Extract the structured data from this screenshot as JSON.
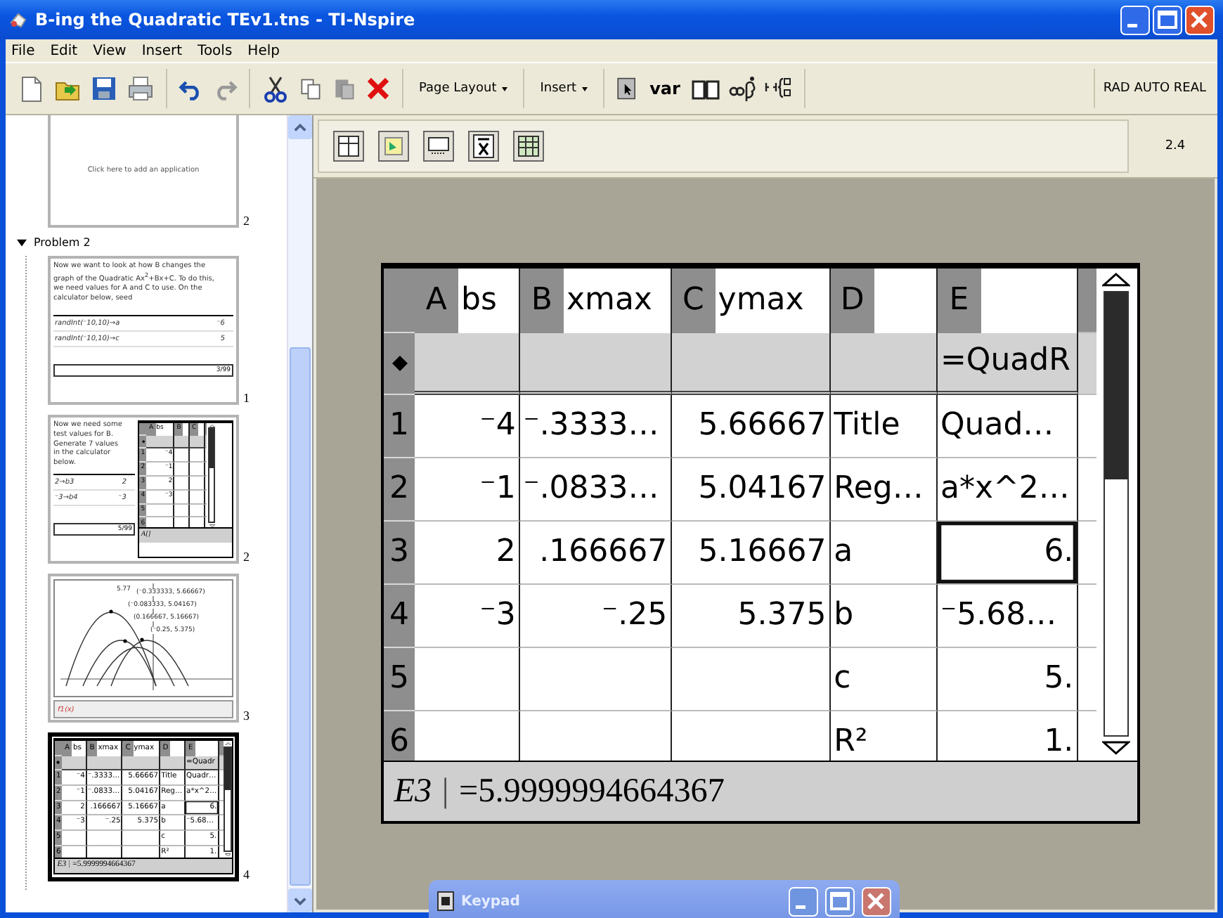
{
  "window": {
    "title": "B-ing the Quadratic TEv1.tns - TI-Nspire"
  },
  "menu": [
    "File",
    "Edit",
    "View",
    "Insert",
    "Tools",
    "Help"
  ],
  "toolbar": {
    "dropdowns": [
      "Page Layout",
      "Insert"
    ],
    "var_button": "var",
    "mode": "RAD AUTO REAL"
  },
  "sidebar": {
    "top_page": {
      "text": "Click here to add an application",
      "number": "2"
    },
    "problem": {
      "title": "Problem 2",
      "expanded": true,
      "pages": [
        {
          "kind": "notes-calc",
          "number": "1",
          "selected": false,
          "notes": "Now we want to look at how B changes the graph of the Quadratic Ax$^{2}$+Bx+C. To do this, we need values for A and C to use. On the calculator below, seed",
          "lines": [
            {
              "input": "randInt(⁻10,10)→a",
              "result": "⁻6"
            },
            {
              "input": "randInt(⁻10,10)→c",
              "result": "5"
            }
          ],
          "status": "3/99"
        },
        {
          "kind": "notes-sheet",
          "number": "2",
          "selected": false,
          "notes": "Now we need some test values for B. Generate 7 values in the calculator below.",
          "lines": [
            {
              "input": "2→b3",
              "result": "2"
            },
            {
              "input": "⁻3→b4",
              "result": "⁻3"
            }
          ],
          "status": "5/99",
          "sheet": {
            "columns": [
              {
                "letter": "A",
                "name": "bs"
              },
              {
                "letter": "B"
              },
              {
                "letter": "C"
              }
            ],
            "rows": [
              {
                "number": "1",
                "cells": [
                  {
                    "text": "⁻4",
                    "selected": false
                  },
                  {
                    "selected": false
                  },
                  {
                    "selected": false
                  }
                ]
              },
              {
                "number": "2",
                "cells": [
                  {
                    "text": "⁻1",
                    "selected": false
                  },
                  {
                    "selected": false
                  },
                  {
                    "selected": false
                  }
                ]
              },
              {
                "number": "3",
                "cells": [
                  {
                    "text": "2",
                    "selected": false
                  },
                  {
                    "selected": false
                  },
                  {
                    "selected": false
                  }
                ]
              },
              {
                "number": "4",
                "cells": [
                  {
                    "text": "⁻3",
                    "selected": false
                  },
                  {
                    "selected": false
                  },
                  {
                    "selected": false
                  }
                ]
              },
              {
                "number": "5",
                "cells": [
                  {
                    "selected": false
                  },
                  {
                    "selected": false
                  },
                  {
                    "selected": false
                  }
                ]
              },
              {
                "number": "6",
                "cells": [
                  {
                    "selected": false
                  },
                  {
                    "selected": false
                  },
                  {
                    "selected": false
                  }
                ]
              }
            ],
            "formula_bar": {
              "cell": "A[]"
            }
          }
        },
        {
          "kind": "graph",
          "number": "3",
          "selected": false,
          "top_label": "5.77",
          "labels": [
            "(⁻0.333333, 5.66667)",
            "(⁻0.083333, 5.04167)",
            "(0.166667, 5.16667)",
            "(⁻0.25, 5.375)"
          ],
          "entry": "f1(x)"
        },
        {
          "kind": "sheet",
          "number": "4",
          "selected": true,
          "sheet": {
            "columns": [
              {
                "letter": "A",
                "name": "bs"
              },
              {
                "letter": "B",
                "name": "xmax"
              },
              {
                "letter": "C",
                "name": "ymax"
              },
              {
                "letter": "D"
              },
              {
                "letter": "E",
                "formula": "=Quadr"
              }
            ],
            "rows": [
              {
                "number": "1",
                "cells": [
                  {
                    "text": "⁻4",
                    "selected": false
                  },
                  {
                    "text": "⁻.3333…",
                    "selected": false
                  },
                  {
                    "text": "5.66667",
                    "selected": false
                  },
                  {
                    "text": "Title",
                    "selected": false
                  },
                  {
                    "text": "Quadr…",
                    "selected": false
                  }
                ]
              },
              {
                "number": "2",
                "cells": [
                  {
                    "text": "⁻1",
                    "selected": false
                  },
                  {
                    "text": "⁻.0833…",
                    "selected": false
                  },
                  {
                    "text": "5.04167",
                    "selected": false
                  },
                  {
                    "text": "Reg…",
                    "selected": false
                  },
                  {
                    "text": "a*x^2…",
                    "selected": false
                  }
                ]
              },
              {
                "number": "3",
                "cells": [
                  {
                    "text": "2",
                    "selected": false
                  },
                  {
                    "text": ".166667",
                    "selected": false
                  },
                  {
                    "text": "5.16667",
                    "selected": false
                  },
                  {
                    "text": "a",
                    "selected": false
                  },
                  {
                    "text": "6.",
                    "selected": true
                  }
                ]
              },
              {
                "number": "4",
                "cells": [
                  {
                    "text": "⁻3",
                    "selected": false
                  },
                  {
                    "text": "⁻.25",
                    "selected": false
                  },
                  {
                    "text": "5.375",
                    "selected": false
                  },
                  {
                    "text": "b",
                    "selected": false
                  },
                  {
                    "text": "⁻5.68…",
                    "selected": false
                  }
                ]
              },
              {
                "number": "5",
                "cells": [
                  {
                    "selected": false
                  },
                  {
                    "selected": false
                  },
                  {
                    "selected": false
                  },
                  {
                    "text": "c",
                    "selected": false
                  },
                  {
                    "text": "5.",
                    "selected": false
                  }
                ]
              },
              {
                "number": "6",
                "cells": [
                  {
                    "selected": false
                  },
                  {
                    "selected": false
                  },
                  {
                    "selected": false
                  },
                  {
                    "text": "R²",
                    "selected": false
                  },
                  {
                    "text": "1.",
                    "selected": false
                  }
                ]
              }
            ],
            "formula_bar": {
              "cell": "E3",
              "separator": "|",
              "value": "=5.9999994664367"
            }
          }
        }
      ]
    }
  },
  "page_number": "2.4",
  "spreadsheet": {
    "columns": [
      {
        "letter": "A",
        "name": "bs"
      },
      {
        "letter": "B",
        "name": "xmax"
      },
      {
        "letter": "C",
        "name": "ymax"
      },
      {
        "letter": "D"
      },
      {
        "letter": "E",
        "formula": "=QuadR"
      }
    ],
    "rows": [
      {
        "number": "1",
        "cells": [
          {
            "text": "⁻4",
            "selected": false
          },
          {
            "text": "⁻.3333…",
            "selected": false
          },
          {
            "text": "5.66667",
            "selected": false
          },
          {
            "text": "Title",
            "selected": false
          },
          {
            "text": "Quad…",
            "selected": false
          }
        ]
      },
      {
        "number": "2",
        "cells": [
          {
            "text": "⁻1",
            "selected": false
          },
          {
            "text": "⁻.0833…",
            "selected": false
          },
          {
            "text": "5.04167",
            "selected": false
          },
          {
            "text": "Reg…",
            "selected": false
          },
          {
            "text": "a*x^2…",
            "selected": false
          }
        ]
      },
      {
        "number": "3",
        "cells": [
          {
            "text": "2",
            "selected": false
          },
          {
            "text": ".166667",
            "selected": false
          },
          {
            "text": "5.16667",
            "selected": false
          },
          {
            "text": "a",
            "selected": false
          },
          {
            "text": "6.",
            "selected": true
          }
        ]
      },
      {
        "number": "4",
        "cells": [
          {
            "text": "⁻3",
            "selected": false
          },
          {
            "text": "⁻.25",
            "selected": false
          },
          {
            "text": "5.375",
            "selected": false
          },
          {
            "text": "b",
            "selected": false
          },
          {
            "text": "⁻5.68…",
            "selected": false
          }
        ]
      },
      {
        "number": "5",
        "cells": [
          {
            "selected": false
          },
          {
            "selected": false
          },
          {
            "selected": false
          },
          {
            "text": "c",
            "selected": false
          },
          {
            "text": "5.",
            "selected": false
          }
        ]
      },
      {
        "number": "6",
        "cells": [
          {
            "selected": false
          },
          {
            "selected": false
          },
          {
            "selected": false
          },
          {
            "text": "R²",
            "selected": false
          },
          {
            "text": "1.",
            "selected": false
          }
        ]
      }
    ],
    "formula_bar": {
      "cell": "E3",
      "separator": "|",
      "value": "=5.9999994664367"
    }
  },
  "keypad": {
    "title": "Keypad"
  }
}
